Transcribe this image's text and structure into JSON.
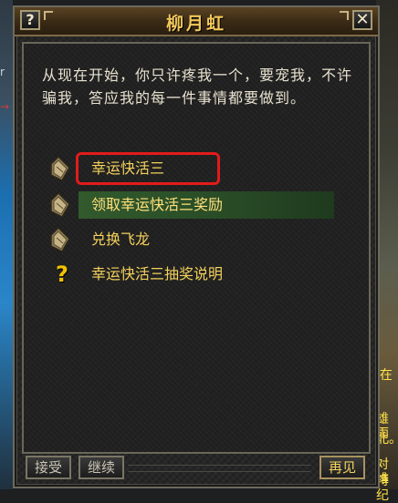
{
  "dialog": {
    "title": "柳月虹",
    "help_label": "?",
    "close_label": "✕",
    "intro_text": "从现在开始，你只许疼我一个，要宠我，不许骗我，答应我的每一件事情都要做到。",
    "options": [
      {
        "label": "幸运快活三",
        "icon": "scroll-icon",
        "state": "selected"
      },
      {
        "label": "领取幸运快活三奖励",
        "icon": "scroll-icon",
        "state": "hover"
      },
      {
        "label": "兑换飞龙",
        "icon": "scroll-icon",
        "state": "normal"
      },
      {
        "label": "幸运快活三抽奖说明",
        "icon": "question-icon",
        "state": "normal"
      }
    ],
    "buttons": {
      "accept": "接受",
      "continue": "继续",
      "goodbye": "再见"
    }
  },
  "background": {
    "right_texts": [
      "l在",
      "雄雨",
      "北。",
      "对维",
      "持纪"
    ],
    "left_texts": [
      "r",
      "→"
    ]
  },
  "colors": {
    "title_gold": "#f2c85a",
    "option_gold": "#f3d15b",
    "selection_red": "#e21b1b",
    "hover_green": "#325a2d"
  }
}
